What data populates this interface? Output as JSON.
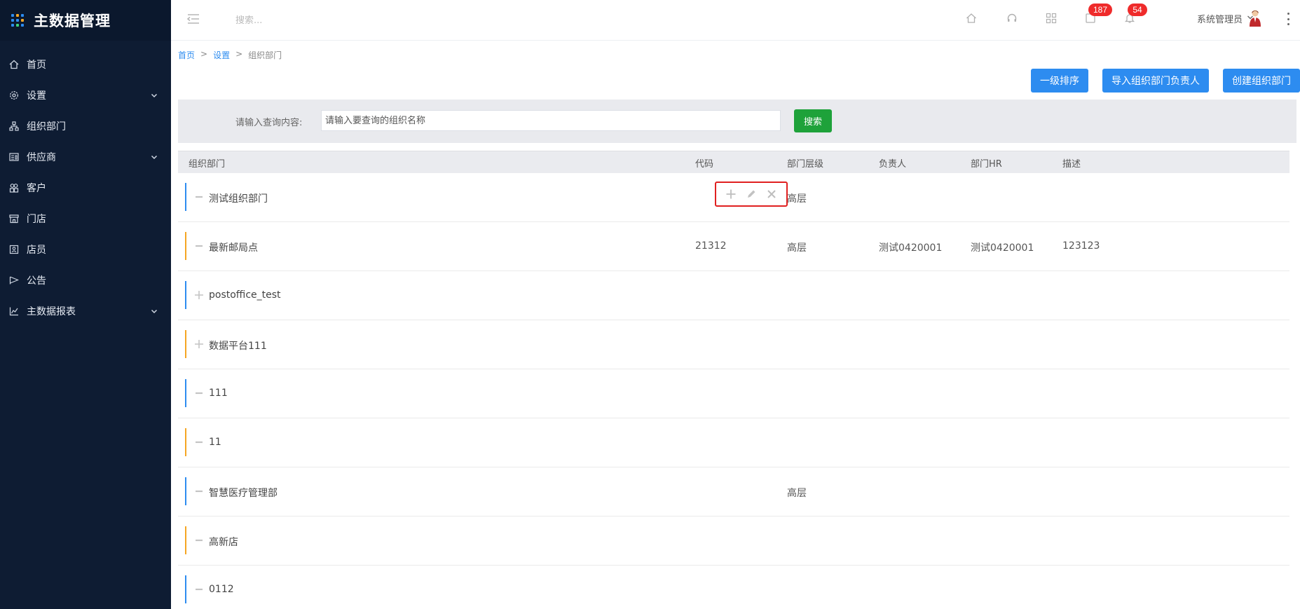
{
  "brand": {
    "title": "主数据管理"
  },
  "sidebar": {
    "items": [
      {
        "label": "首页",
        "icon": "home-icon",
        "expandable": false
      },
      {
        "label": "设置",
        "icon": "gear-icon",
        "expandable": true
      },
      {
        "label": "组织部门",
        "icon": "org-chart-icon",
        "expandable": false
      },
      {
        "label": "供应商",
        "icon": "supplier-icon",
        "expandable": true
      },
      {
        "label": "客户",
        "icon": "customer-icon",
        "expandable": false
      },
      {
        "label": "门店",
        "icon": "store-icon",
        "expandable": false
      },
      {
        "label": "店员",
        "icon": "clerk-icon",
        "expandable": false
      },
      {
        "label": "公告",
        "icon": "announcement-icon",
        "expandable": false
      },
      {
        "label": "主数据报表",
        "icon": "chart-icon",
        "expandable": true
      }
    ]
  },
  "topbar": {
    "search_placeholder": "搜索...",
    "messages_badge": "187",
    "notifications_badge": "54",
    "user_name": "系统管理员"
  },
  "breadcrumb": {
    "home": "首页",
    "settings": "设置",
    "current": "组织部门",
    "sep": ">"
  },
  "actions": {
    "sort_label": "一级排序",
    "import_label": "导入组织部门负责人",
    "create_label": "创建组织部门"
  },
  "search": {
    "label": "请输入查询内容:",
    "placeholder": "请输入要查询的组织名称",
    "button_label": "搜索"
  },
  "table": {
    "headers": {
      "name": "组织部门",
      "code": "代码",
      "level": "部门层级",
      "owner": "负责人",
      "hr": "部门HR",
      "desc": "描述"
    },
    "rows": [
      {
        "name": "测试组织部门",
        "code": "",
        "level": "高层",
        "owner": "",
        "hr": "",
        "desc": "",
        "expanded": true,
        "bar_color": "#2d8cf0"
      },
      {
        "name": "最新邮局点",
        "code": "21312",
        "level": "高层",
        "owner": "测试0420001",
        "hr": "测试0420001",
        "desc": "123123",
        "expanded": true,
        "bar_color": "#f5a623"
      },
      {
        "name": "postoffice_test",
        "code": "",
        "level": "",
        "owner": "",
        "hr": "",
        "desc": "",
        "expanded": false,
        "bar_color": "#2d8cf0"
      },
      {
        "name": "数据平台111",
        "code": "",
        "level": "",
        "owner": "",
        "hr": "",
        "desc": "",
        "expanded": false,
        "bar_color": "#f5a623"
      },
      {
        "name": "111",
        "code": "",
        "level": "",
        "owner": "",
        "hr": "",
        "desc": "",
        "expanded": true,
        "bar_color": "#2d8cf0"
      },
      {
        "name": "11",
        "code": "",
        "level": "",
        "owner": "",
        "hr": "",
        "desc": "",
        "expanded": true,
        "bar_color": "#f5a623"
      },
      {
        "name": "智慧医疗管理部",
        "code": "",
        "level": "高层",
        "owner": "",
        "hr": "",
        "desc": "",
        "expanded": true,
        "bar_color": "#2d8cf0"
      },
      {
        "name": "高新店",
        "code": "",
        "level": "",
        "owner": "",
        "hr": "",
        "desc": "",
        "expanded": true,
        "bar_color": "#f5a623"
      },
      {
        "name": "0112",
        "code": "",
        "level": "",
        "owner": "",
        "hr": "",
        "desc": "",
        "expanded": true,
        "bar_color": "#2d8cf0"
      }
    ],
    "row_action_icons": [
      "add-icon",
      "edit-icon",
      "delete-icon"
    ]
  },
  "colors": {
    "primary": "#2d8cf0",
    "success": "#1ea23a",
    "sidebar_bg": "#0e1c33",
    "badge": "#ef2b2b",
    "highlight": "#e02020"
  }
}
